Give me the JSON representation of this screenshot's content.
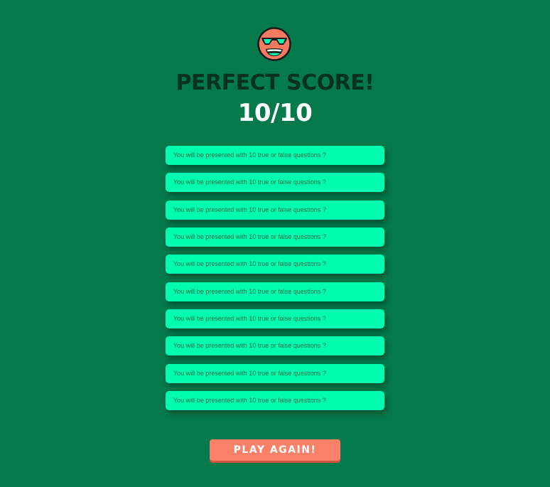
{
  "result": {
    "title": "PERFECT SCORE!",
    "score": "10/10",
    "emoji_icon": "sunglasses-grin-icon"
  },
  "answers": [
    "You will be presented with 10 true or false questions ?",
    "You will be presented with 10 true or false questions ?",
    "You will be presented with 10 true or false questions ?",
    "You will be presented with 10 true or false questions ?",
    "You will be presented with 10 true or false questions ?",
    "You will be presented with 10 true or false questions ?",
    "You will be presented with 10 true or false questions ?",
    "You will be presented with 10 true or false questions ?",
    "You will be presented with 10 true or false questions ?",
    "You will be presented with 10 true or false questions ?"
  ],
  "actions": {
    "play_again_label": "PLAY AGAIN!"
  },
  "colors": {
    "background": "#047a4b",
    "title": "#07331c",
    "card": "#00fcae",
    "card_text": "#1f6a4b",
    "button": "#fa8068",
    "emoji_face": "#f47a61",
    "sunglasses": "#00fcae"
  }
}
